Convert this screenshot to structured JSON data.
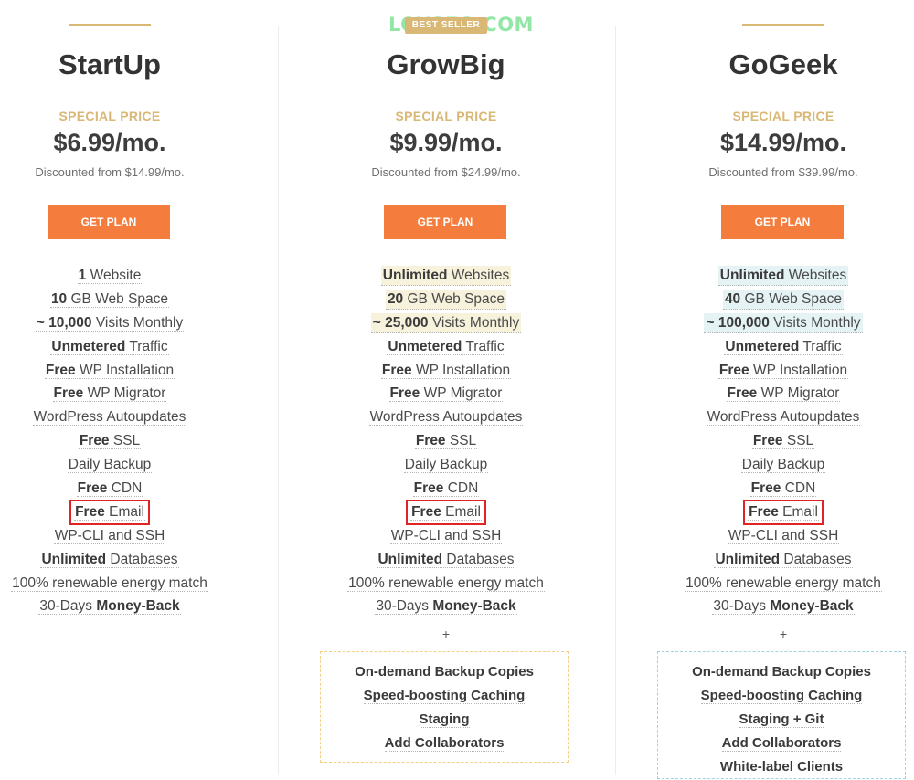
{
  "watermark": "LOYSEO.COM",
  "plans": [
    {
      "name": "StartUp",
      "special": "SPECIAL PRICE",
      "price": "$6.99/mo.",
      "discount": "Discounted from $14.99/mo.",
      "button": "GET PLAN",
      "features": [
        {
          "b": "1",
          "t": " Website"
        },
        {
          "b": "10",
          "t": " GB Web Space"
        },
        {
          "b": "~ 10,000",
          "t": " Visits Monthly"
        },
        {
          "b": "Unmetered",
          "t": " Traffic"
        },
        {
          "b": "Free",
          "t": " WP Installation"
        },
        {
          "b": "Free",
          "t": " WP Migrator"
        },
        {
          "b": "",
          "t": "WordPress Autoupdates"
        },
        {
          "b": "Free",
          "t": " SSL"
        },
        {
          "b": "",
          "t": "Daily Backup"
        },
        {
          "b": "Free",
          "t": " CDN"
        },
        {
          "b": "Free",
          "t": " Email"
        },
        {
          "b": "",
          "t": "WP-CLI and SSH"
        },
        {
          "b": "Unlimited",
          "t": " Databases"
        },
        {
          "b": "",
          "t": "100% renewable energy match"
        },
        {
          "pre": "30-Days ",
          "b": "Money-Back",
          "t": ""
        }
      ]
    },
    {
      "badge": "BEST SELLER",
      "name": "GrowBig",
      "special": "SPECIAL PRICE",
      "price": "$9.99/mo.",
      "discount": "Discounted from $24.99/mo.",
      "button": "GET PLAN",
      "features": [
        {
          "b": "Unlimited",
          "t": " Websites"
        },
        {
          "b": "20",
          "t": " GB Web Space"
        },
        {
          "b": "~ 25,000",
          "t": " Visits Monthly"
        },
        {
          "b": "Unmetered",
          "t": " Traffic"
        },
        {
          "b": "Free",
          "t": " WP Installation"
        },
        {
          "b": "Free",
          "t": " WP Migrator"
        },
        {
          "b": "",
          "t": "WordPress Autoupdates"
        },
        {
          "b": "Free",
          "t": " SSL"
        },
        {
          "b": "",
          "t": "Daily Backup"
        },
        {
          "b": "Free",
          "t": " CDN"
        },
        {
          "b": "Free",
          "t": " Email"
        },
        {
          "b": "",
          "t": "WP-CLI and SSH"
        },
        {
          "b": "Unlimited",
          "t": " Databases"
        },
        {
          "b": "",
          "t": "100% renewable energy match"
        },
        {
          "pre": "30-Days ",
          "b": "Money-Back",
          "t": ""
        }
      ],
      "plus": "+",
      "extras": [
        "On-demand Backup Copies",
        "Speed-boosting Caching",
        "Staging",
        "Add Collaborators"
      ]
    },
    {
      "name": "GoGeek",
      "special": "SPECIAL PRICE",
      "price": "$14.99/mo.",
      "discount": "Discounted from $39.99/mo.",
      "button": "GET PLAN",
      "features": [
        {
          "b": "Unlimited",
          "t": " Websites"
        },
        {
          "b": "40",
          "t": " GB Web Space"
        },
        {
          "b": "~ 100,000",
          "t": " Visits Monthly"
        },
        {
          "b": "Unmetered",
          "t": " Traffic"
        },
        {
          "b": "Free",
          "t": " WP Installation"
        },
        {
          "b": "Free",
          "t": " WP Migrator"
        },
        {
          "b": "",
          "t": "WordPress Autoupdates"
        },
        {
          "b": "Free",
          "t": " SSL"
        },
        {
          "b": "",
          "t": "Daily Backup"
        },
        {
          "b": "Free",
          "t": " CDN"
        },
        {
          "b": "Free",
          "t": " Email"
        },
        {
          "b": "",
          "t": "WP-CLI and SSH"
        },
        {
          "b": "Unlimited",
          "t": " Databases"
        },
        {
          "b": "",
          "t": "100% renewable energy match"
        },
        {
          "pre": "30-Days ",
          "b": "Money-Back",
          "t": ""
        }
      ],
      "plus": "+",
      "extras": [
        "On-demand Backup Copies",
        "Speed-boosting Caching",
        "Staging + Git",
        "Add Collaborators",
        "White-label Clients"
      ]
    }
  ]
}
